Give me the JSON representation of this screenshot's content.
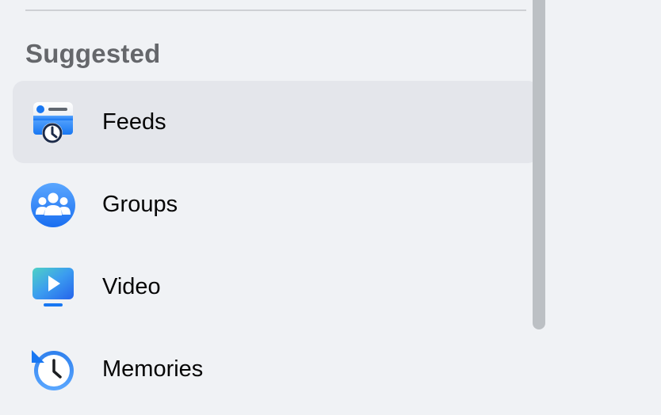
{
  "sidebar": {
    "section_title": "Suggested",
    "items": [
      {
        "label": "Feeds",
        "icon": "feeds-icon",
        "active": true
      },
      {
        "label": "Groups",
        "icon": "groups-icon",
        "active": false
      },
      {
        "label": "Video",
        "icon": "video-icon",
        "active": false
      },
      {
        "label": "Memories",
        "icon": "memories-icon",
        "active": false
      }
    ]
  },
  "colors": {
    "background": "#f0f2f5",
    "active_item": "#e4e6eb",
    "section_title": "#65676b",
    "label": "#050505",
    "accent_blue": "#1877f2",
    "scrollbar": "#bcc0c4"
  }
}
